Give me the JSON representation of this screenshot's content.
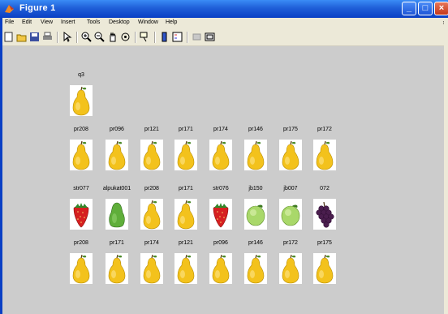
{
  "window": {
    "title": "Figure 1",
    "controls": [
      "minimize",
      "maximize",
      "close"
    ]
  },
  "menu": [
    "File",
    "Edit",
    "View",
    "Insert",
    "Tools",
    "Desktop",
    "Window",
    "Help"
  ],
  "toolbar": [
    "new-figure-icon",
    "open-file-icon",
    "save-icon",
    "print-icon",
    "edit-plot-icon",
    "zoom-in-icon",
    "zoom-out-icon",
    "pan-icon",
    "rotate-icon",
    "data-cursor-icon",
    "colorbar-icon",
    "legend-icon",
    "hide-plot-tools-icon",
    "show-plot-tools-icon"
  ],
  "images": [
    {
      "label": "q3",
      "fruit": "pear"
    },
    {
      "label": "pr208",
      "fruit": "pear"
    },
    {
      "label": "pr096",
      "fruit": "pear"
    },
    {
      "label": "pr121",
      "fruit": "pear"
    },
    {
      "label": "pr171",
      "fruit": "pear"
    },
    {
      "label": "pr174",
      "fruit": "pear"
    },
    {
      "label": "pr146",
      "fruit": "pear"
    },
    {
      "label": "pr175",
      "fruit": "pear"
    },
    {
      "label": "pr172",
      "fruit": "pear"
    },
    {
      "label": "str077",
      "fruit": "strawberry"
    },
    {
      "label": "alpukat001",
      "fruit": "avocado"
    },
    {
      "label": "pr208",
      "fruit": "pear"
    },
    {
      "label": "pr171",
      "fruit": "pear"
    },
    {
      "label": "str076",
      "fruit": "strawberry"
    },
    {
      "label": "jb150",
      "fruit": "lime"
    },
    {
      "label": "jb007",
      "fruit": "lime"
    },
    {
      "label": "072",
      "fruit": "grapes"
    },
    {
      "label": "pr208",
      "fruit": "pear"
    },
    {
      "label": "pr171",
      "fruit": "pear"
    },
    {
      "label": "pr174",
      "fruit": "pear"
    },
    {
      "label": "pr121",
      "fruit": "pear"
    },
    {
      "label": "pr096",
      "fruit": "pear"
    },
    {
      "label": "pr146",
      "fruit": "pear"
    },
    {
      "label": "pr172",
      "fruit": "pear"
    },
    {
      "label": "pr175",
      "fruit": "pear"
    }
  ]
}
